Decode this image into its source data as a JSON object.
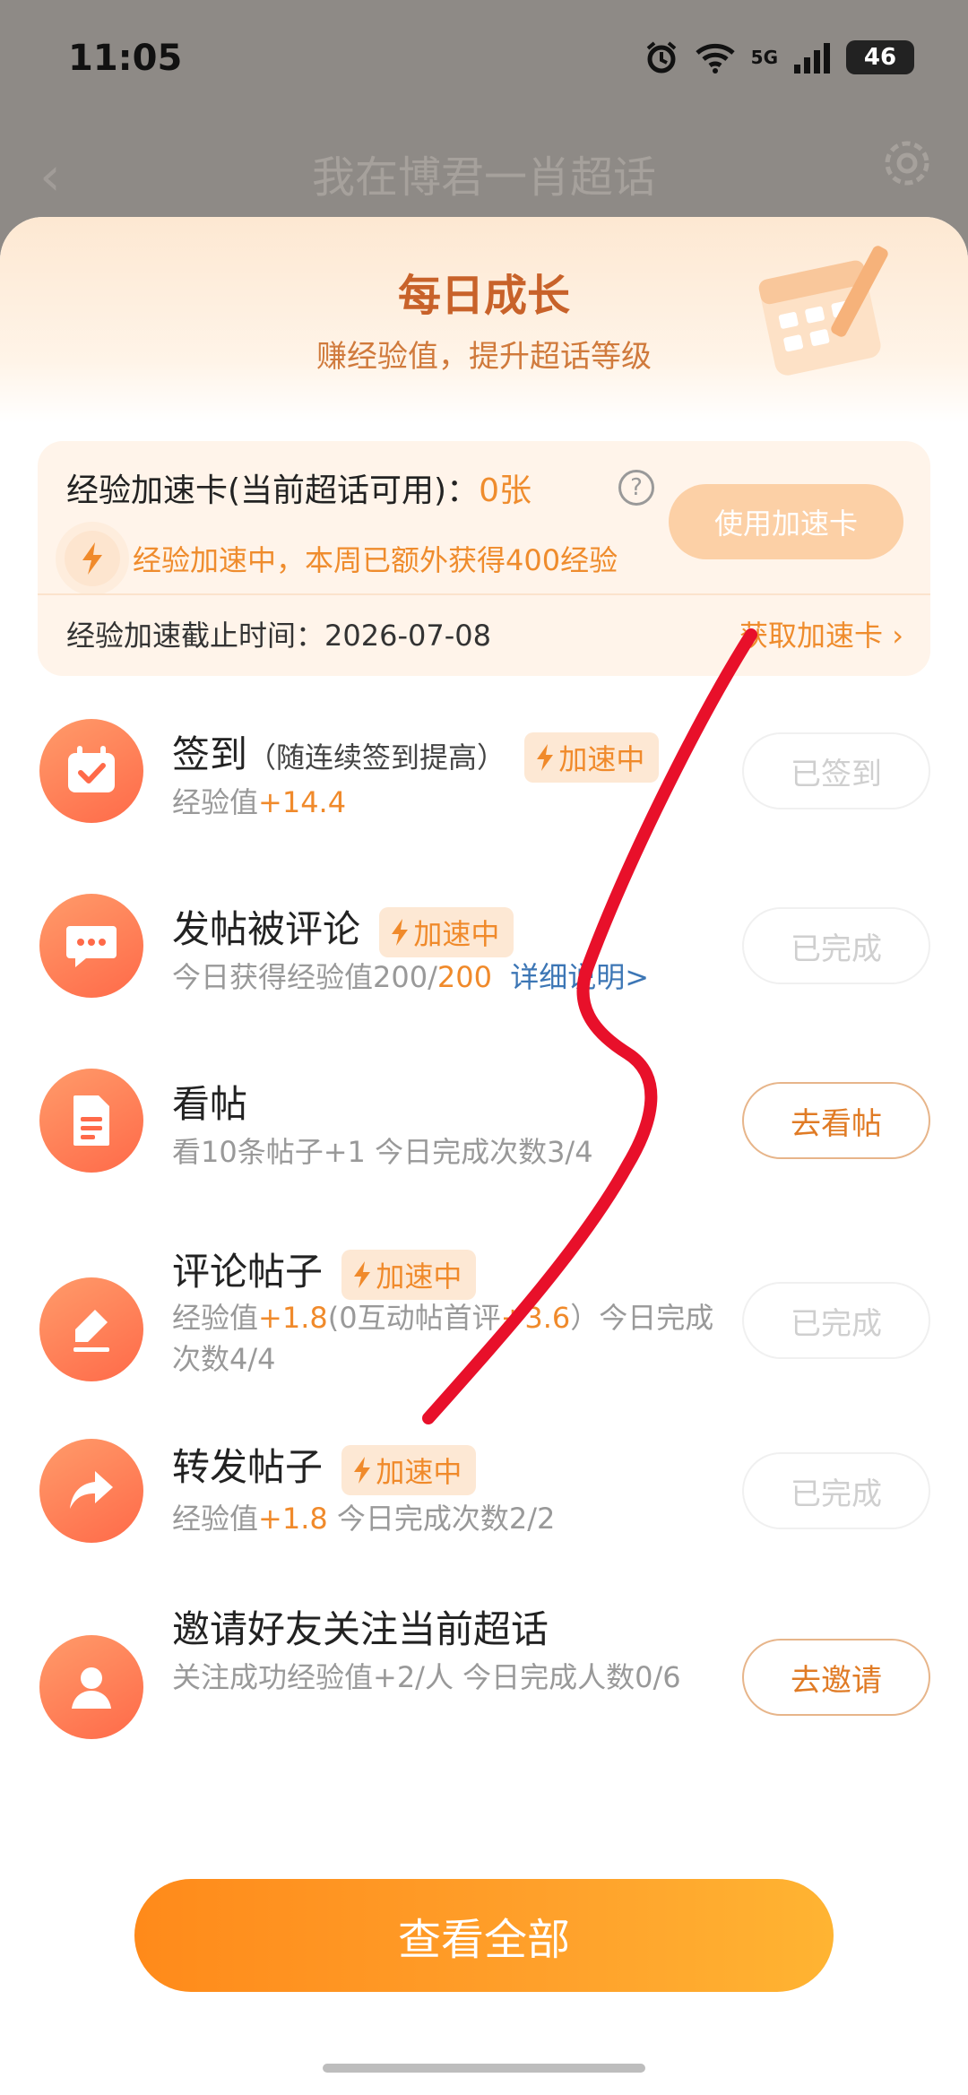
{
  "status_bar": {
    "time": "11:05",
    "network": "5G",
    "battery": "46"
  },
  "background_header": {
    "back": "‹",
    "title": "我在博君一肖超话"
  },
  "sheet": {
    "title": "每日成长",
    "subtitle": "赚经验值，提升超话等级"
  },
  "speed_card": {
    "label": "经验加速卡(当前超话可用)：",
    "count": "0张",
    "help": "?",
    "use_button": "使用加速卡",
    "boost_status": "经验加速中，本周已额外获得400经验",
    "deadline": "经验加速截止时间：2026-07-08",
    "get_card": "获取加速卡 ›"
  },
  "badge_label": "加速中",
  "tasks": [
    {
      "name": "签到",
      "note": "（随连续签到提高）",
      "desc_prefix": "经验值",
      "desc_value": "+14.4",
      "button": "已签到"
    },
    {
      "name": "发帖被评论",
      "desc_prefix": "今日获得经验值200/",
      "desc_value": "200",
      "link": "详细说明>",
      "button": "已完成"
    },
    {
      "name": "看帖",
      "desc": "看10条帖子+1   今日完成次数3/4",
      "button": "去看帖"
    },
    {
      "name": "评论帖子",
      "desc_a": "经验值",
      "desc_b": "+1.8",
      "desc_c": "(0互动帖首评",
      "desc_d": "+3.6",
      "desc_e": "）今日完成次数4/4",
      "button": "已完成"
    },
    {
      "name": "转发帖子",
      "desc_a": "经验值",
      "desc_b": "+1.8",
      "desc_c": "  今日完成次数2/2",
      "button": "已完成"
    },
    {
      "name": "邀请好友关注当前超话",
      "desc": "关注成功经验值+2/人   今日完成人数0/6",
      "button": "去邀请"
    }
  ],
  "view_all": "查看全部",
  "colors": {
    "accent": "#ef8c2d",
    "button_gradient_start": "#ff8a1a",
    "icon_gradient": "#ff6a49",
    "scribble": "#e8102a"
  }
}
